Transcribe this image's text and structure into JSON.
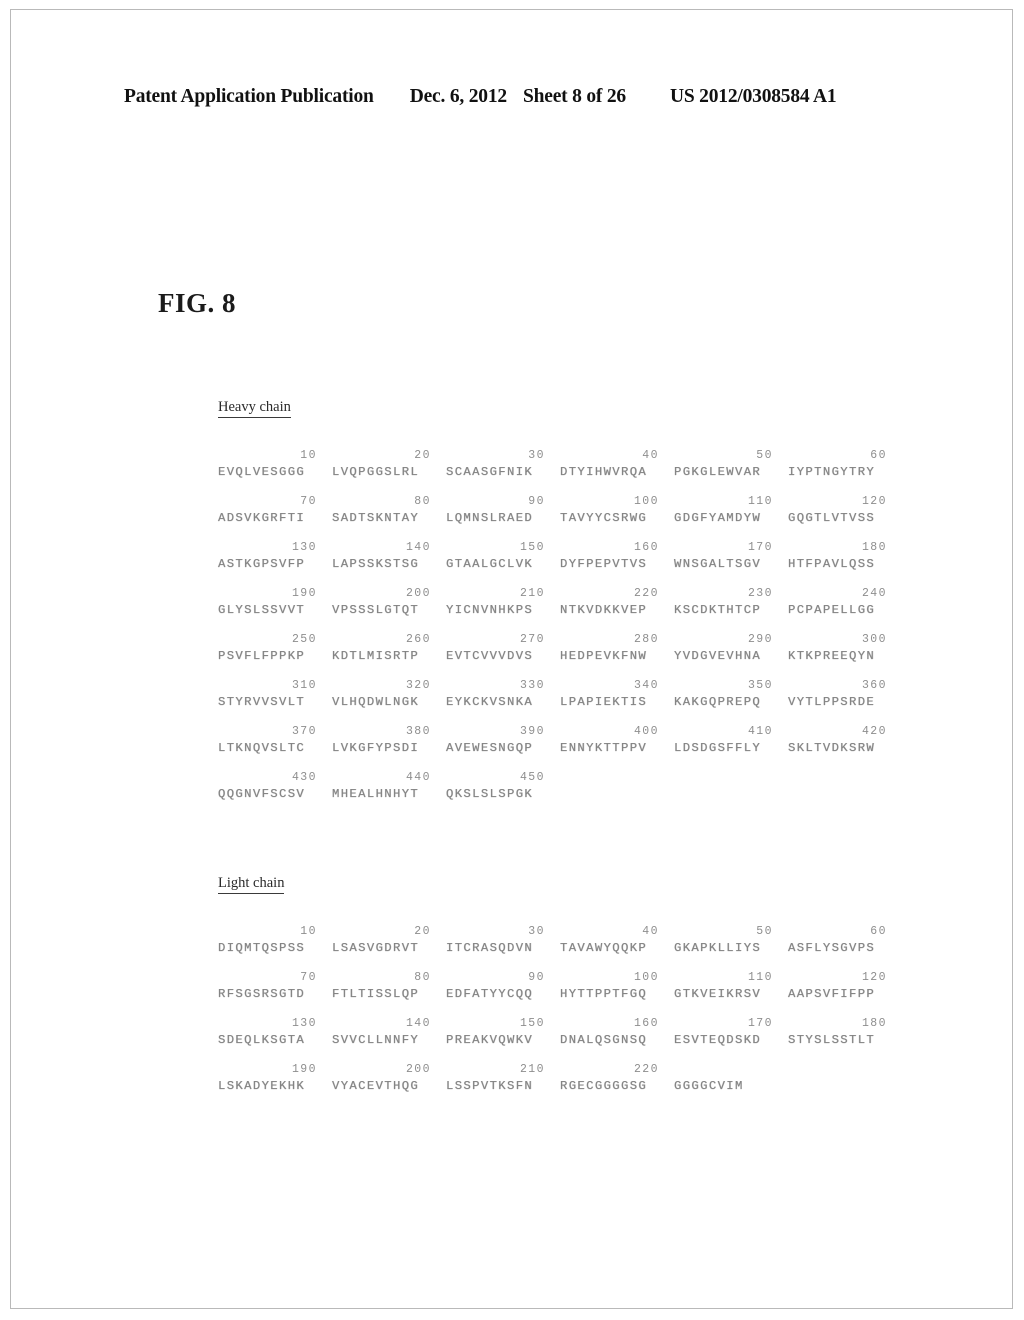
{
  "header": {
    "publication": "Patent Application Publication",
    "date": "Dec. 6, 2012",
    "sheet": "Sheet 8 of 26",
    "number": "US 2012/0308584 A1"
  },
  "figure": {
    "label": "FIG. 8"
  },
  "sections": [
    {
      "id": "heavy-chain",
      "heading": "Heavy chain",
      "rows": [
        {
          "numbers": [
            "10",
            "20",
            "30",
            "40",
            "50",
            "60"
          ],
          "residues": [
            "EVQLVESGGG",
            "LVQPGGSLRL",
            "SCAASGFNIK",
            "DTYIHWVRQA",
            "PGKGLEWVAR",
            "IYPTNGYTRY"
          ]
        },
        {
          "numbers": [
            "70",
            "80",
            "90",
            "100",
            "110",
            "120"
          ],
          "residues": [
            "ADSVKGRFTI",
            "SADTSKNTAY",
            "LQMNSLRAED",
            "TAVYYCSRWG",
            "GDGFYAMDYW",
            "GQGTLVTVSS"
          ]
        },
        {
          "numbers": [
            "130",
            "140",
            "150",
            "160",
            "170",
            "180"
          ],
          "residues": [
            "ASTKGPSVFP",
            "LAPSSKSTSG",
            "GTAALGCLVK",
            "DYFPEPVTVS",
            "WNSGALTSGV",
            "HTFPAVLQSS"
          ]
        },
        {
          "numbers": [
            "190",
            "200",
            "210",
            "220",
            "230",
            "240"
          ],
          "residues": [
            "GLYSLSSVVT",
            "VPSSSLGTQT",
            "YICNVNHKPS",
            "NTKVDKKVEP",
            "KSCDKTHTCP",
            "PCPAPELLGG"
          ]
        },
        {
          "numbers": [
            "250",
            "260",
            "270",
            "280",
            "290",
            "300"
          ],
          "residues": [
            "PSVFLFPPKP",
            "KDTLMISRTP",
            "EVTCVVVDVS",
            "HEDPEVKFNW",
            "YVDGVEVHNA",
            "KTKPREEQYN"
          ]
        },
        {
          "numbers": [
            "310",
            "320",
            "330",
            "340",
            "350",
            "360"
          ],
          "residues": [
            "STYRVVSVLT",
            "VLHQDWLNGK",
            "EYKCKVSNKA",
            "LPAPIEKTIS",
            "KAKGQPREPQ",
            "VYTLPPSRDE"
          ]
        },
        {
          "numbers": [
            "370",
            "380",
            "390",
            "400",
            "410",
            "420"
          ],
          "residues": [
            "LTKNQVSLTC",
            "LVKGFYPSDI",
            "AVEWESNGQP",
            "ENNYKTTPPV",
            "LDSDGSFFLY",
            "SKLTVDKSRW"
          ]
        },
        {
          "numbers": [
            "430",
            "440",
            "450"
          ],
          "residues": [
            "QQGNVFSCSV",
            "MHEALHNHYT",
            "QKSLSLSPGK"
          ]
        }
      ]
    },
    {
      "id": "light-chain",
      "heading": "Light chain",
      "rows": [
        {
          "numbers": [
            "10",
            "20",
            "30",
            "40",
            "50",
            "60"
          ],
          "residues": [
            "DIQMTQSPSS",
            "LSASVGDRVT",
            "ITCRASQDVN",
            "TAVAWYQQKP",
            "GKAPKLLIYS",
            "ASFLYSGVPS"
          ]
        },
        {
          "numbers": [
            "70",
            "80",
            "90",
            "100",
            "110",
            "120"
          ],
          "residues": [
            "RFSGSRSGTD",
            "FTLTISSLQP",
            "EDFATYYCQQ",
            "HYTTPPTFGQ",
            "GTKVEIKRSV",
            "AAPSVFIFPP"
          ]
        },
        {
          "numbers": [
            "130",
            "140",
            "150",
            "160",
            "170",
            "180"
          ],
          "residues": [
            "SDEQLKSGTA",
            "SVVCLLNNFY",
            "PREAKVQWKV",
            "DNALQSGNSQ",
            "ESVTEQDSKD",
            "STYSLSSTLT"
          ]
        },
        {
          "numbers": [
            "190",
            "200",
            "210",
            "220"
          ],
          "residues": [
            "LSKADYEKHK",
            "VYACEVTHQG",
            "LSSPVTKSFN",
            "RGECGGGGSG",
            "GGGGCVIM"
          ]
        }
      ]
    }
  ]
}
